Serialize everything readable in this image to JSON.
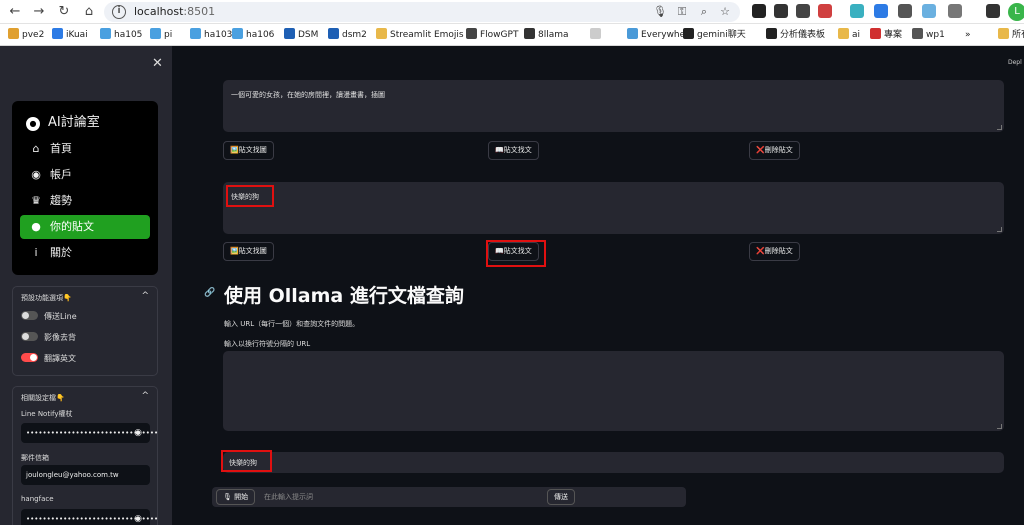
{
  "browser": {
    "url_host": "localhost",
    "url_port": ":8501",
    "avatar_letter": "L",
    "bookmarks": [
      {
        "label": "pve2",
        "color": "#e0a030"
      },
      {
        "label": "iKuai",
        "color": "#2d7be5"
      },
      {
        "label": "ha105",
        "color": "#4aa0e0"
      },
      {
        "label": "pi",
        "color": "#4aa0e0"
      },
      {
        "label": "ha103",
        "color": "#4aa0e0"
      },
      {
        "label": "ha106",
        "color": "#4aa0e0"
      },
      {
        "label": "DSM",
        "color": "#1e5fb4"
      },
      {
        "label": "dsm2",
        "color": "#1e5fb4"
      },
      {
        "label": "Streamlit Emojis",
        "color": "#e8b84a"
      },
      {
        "label": "FlowGPT",
        "color": "#444444"
      },
      {
        "label": "8llama",
        "color": "#333333"
      },
      {
        "label": "",
        "color": "#cccccc"
      },
      {
        "label": "Everywhere",
        "color": "#4a9ad8"
      },
      {
        "label": "gemini聊天",
        "color": "#222222"
      },
      {
        "label": "分析儀表板",
        "color": "#222222"
      },
      {
        "label": "ai",
        "color": "#e8b84a"
      },
      {
        "label": "專案",
        "color": "#d03030"
      },
      {
        "label": "wp1",
        "color": "#555555"
      },
      {
        "label": "»",
        "color": ""
      },
      {
        "label": "所有",
        "color": "#e8b84a"
      }
    ]
  },
  "sidebar": {
    "menu_title": "AI討論室",
    "items": [
      {
        "icon": "house-icon",
        "glyph": "⌂",
        "label": "首頁"
      },
      {
        "icon": "user-circle-icon",
        "glyph": "◉",
        "label": "帳戶"
      },
      {
        "icon": "trophy-icon",
        "glyph": "♛",
        "label": "趨勢"
      },
      {
        "icon": "chat-icon",
        "glyph": "●",
        "label": "你的貼文"
      },
      {
        "icon": "info-icon",
        "glyph": "i",
        "label": "關於"
      }
    ],
    "active_item": "你的貼文",
    "expander1": {
      "title": "預設功能選項👇",
      "toggles": [
        {
          "label": "傳送Line",
          "on": false
        },
        {
          "label": "影像去背",
          "on": false
        },
        {
          "label": "翻譯英文",
          "on": true
        }
      ]
    },
    "expander2": {
      "title": "相關設定檔👇",
      "fields": [
        {
          "label": "Line Notify權杖",
          "value": "••••••••••••••••••••••••••••••••"
        },
        {
          "label": "郵件信箱",
          "value": "joulongleu@yahoo.com.tw"
        },
        {
          "label": "hangface",
          "value": "••••••••••••••••••••••••••••••••"
        }
      ]
    }
  },
  "main": {
    "deploy_label": "Depl",
    "post1_text": "一個可愛的女孩，在她的房間裡，讀漫畫書，插圖",
    "post2_text": "快樂的狗",
    "buttons": {
      "find_image": "🖼️貼文找圖",
      "find_text": "📖貼文找文",
      "delete": "❌刪除貼文"
    },
    "heading": "使用 Ollama 進行文檔查詢",
    "description": "輸入 URL（每行一個）和查詢文件的問題。",
    "url_label": "輸入以換行符號分隔的 URL",
    "query_value": "快樂的狗",
    "chat": {
      "start_label": "🎙 開始",
      "placeholder": "在此輸入提示詞",
      "send_label": "傳送"
    }
  }
}
